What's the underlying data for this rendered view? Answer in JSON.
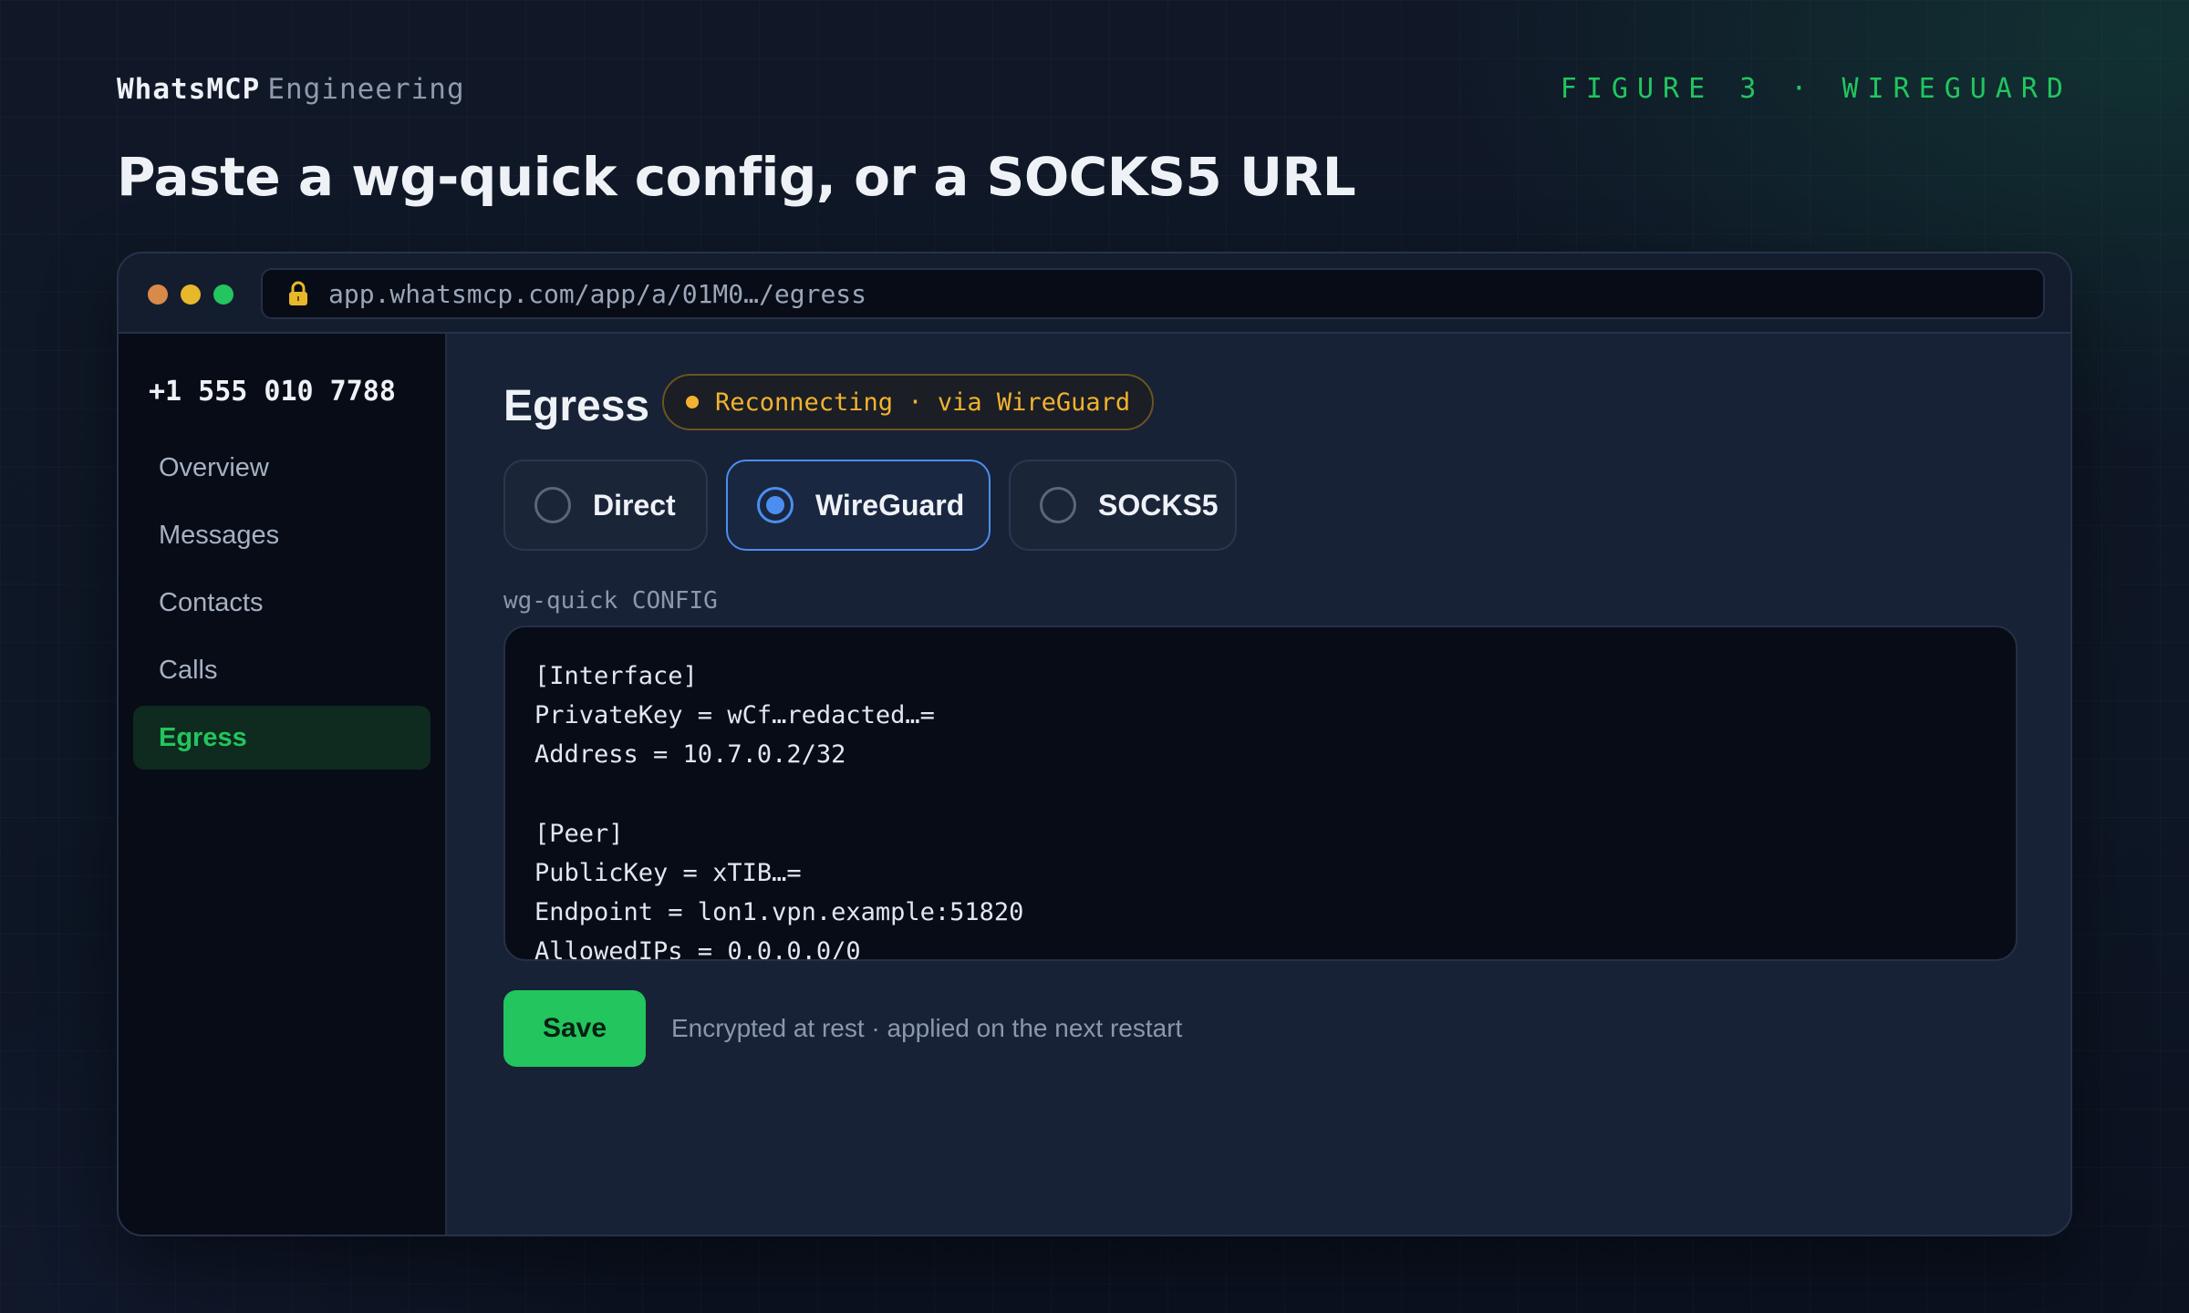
{
  "header": {
    "brand": "WhatsMCP",
    "brand_sub": "Engineering",
    "figure_label": "FIGURE 3 · WIREGUARD",
    "headline": "Paste a wg-quick config, or a SOCKS5 URL"
  },
  "browser": {
    "url": "app.whatsmcp.com/app/a/01M0…/egress",
    "lock_icon": "lock-icon"
  },
  "sidebar": {
    "phone": "+1 555 010 7788",
    "items": [
      {
        "label": "Overview",
        "active": false
      },
      {
        "label": "Messages",
        "active": false
      },
      {
        "label": "Contacts",
        "active": false
      },
      {
        "label": "Calls",
        "active": false
      },
      {
        "label": "Egress",
        "active": true
      }
    ]
  },
  "main": {
    "title": "Egress",
    "status": "Reconnecting · via WireGuard",
    "status_color": "#f2b22f",
    "modes": [
      {
        "label": "Direct",
        "selected": false
      },
      {
        "label": "WireGuard",
        "selected": true
      },
      {
        "label": "SOCKS5",
        "selected": false
      }
    ],
    "config_label": "wg-quick CONFIG",
    "config_text": "[Interface]\nPrivateKey = wCf…redacted…=\nAddress = 10.7.0.2/32\n\n[Peer]\nPublicKey = xTIB…=\nEndpoint = lon1.vpn.example:51820\nAllowedIPs = 0.0.0.0/0",
    "save_label": "Save",
    "save_hint": "Encrypted at rest · applied on the next restart",
    "accent_color": "#22c55e",
    "selected_color": "#4b8ef0"
  }
}
